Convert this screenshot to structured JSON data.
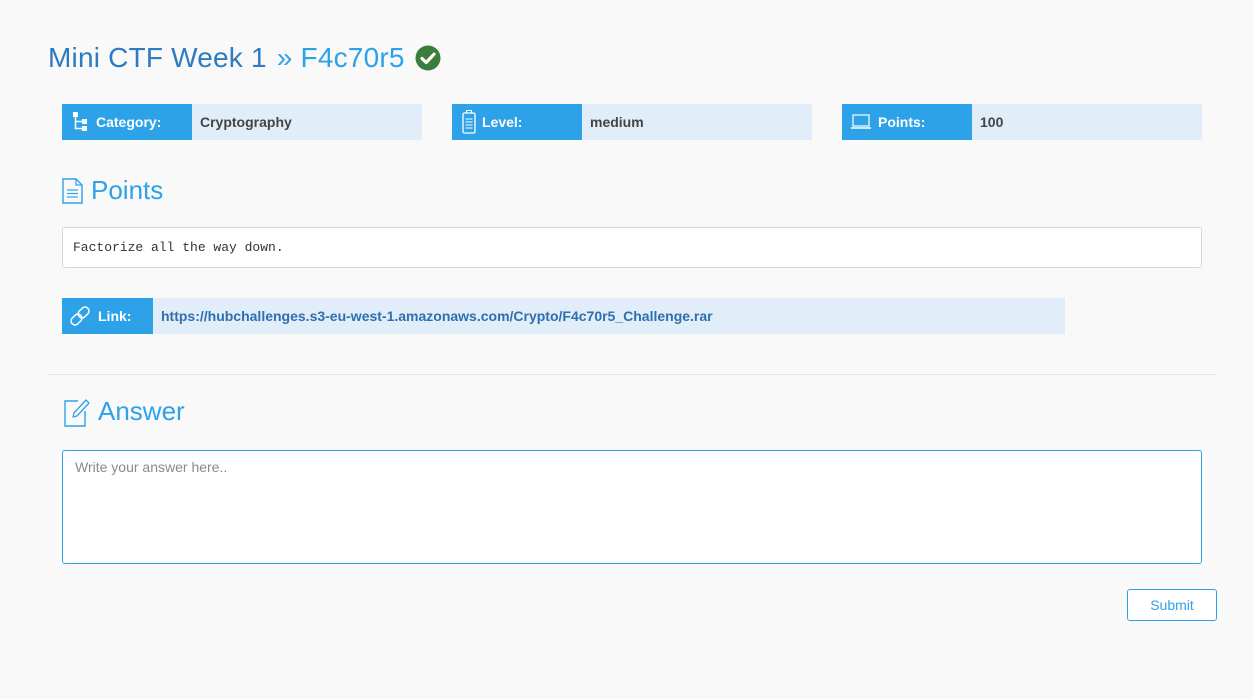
{
  "header": {
    "event_title": "Mini CTF Week 1",
    "separator": "»",
    "challenge_title": "F4c70r5",
    "solved_icon": "check-circle-icon"
  },
  "info": {
    "category": {
      "label": "Category:",
      "value": "Cryptography",
      "icon": "hierarchy-icon"
    },
    "level": {
      "label": "Level:",
      "value": "medium",
      "icon": "battery-icon"
    },
    "points": {
      "label": "Points:",
      "value": "100",
      "icon": "laptop-icon"
    }
  },
  "description_section": {
    "heading": "Points",
    "icon": "document-icon",
    "text": "Factorize all the way down."
  },
  "link": {
    "label": "Link:",
    "icon": "chain-link-icon",
    "url": "https://hubchallenges.s3-eu-west-1.amazonaws.com/Crypto/F4c70r5_Challenge.rar"
  },
  "answer_section": {
    "heading": "Answer",
    "icon": "edit-icon",
    "placeholder": "Write your answer here..",
    "submit_label": "Submit"
  },
  "colors": {
    "accent": "#2ea2e8",
    "title_dark_blue": "#2e7bbf",
    "label_bg": "#2ea2e8",
    "value_bg": "#e1edf8",
    "solved_green": "#3a7d3c",
    "page_bg": "#f9f9f9"
  }
}
